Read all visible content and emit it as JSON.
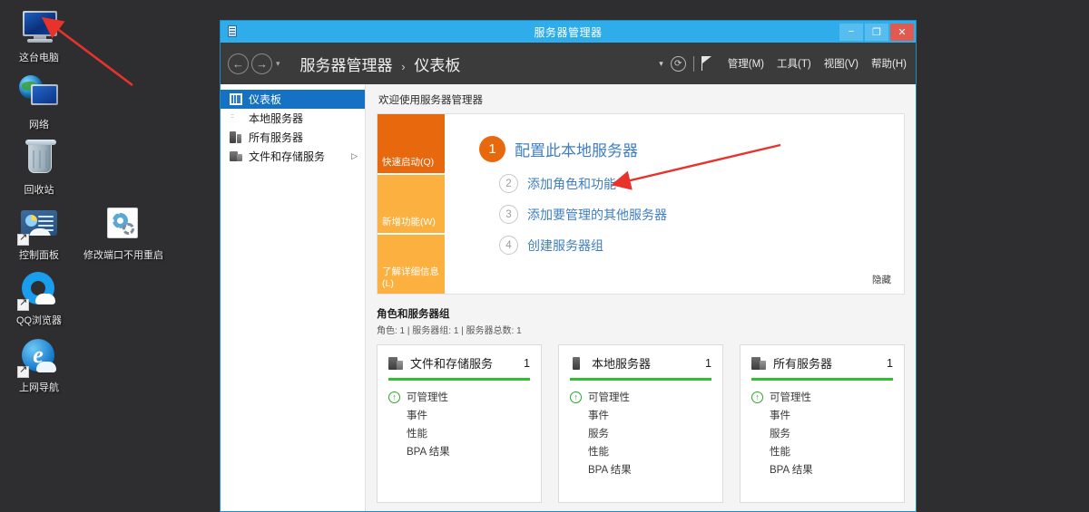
{
  "desktop": {
    "icons": [
      {
        "label": "这台电脑",
        "icon": "my-computer-icon"
      },
      {
        "label": "网络",
        "icon": "network-icon"
      },
      {
        "label": "回收站",
        "icon": "recycle-bin-icon"
      },
      {
        "label": "控制面板",
        "icon": "control-panel-icon"
      },
      {
        "label": "修改端口不用重启",
        "icon": "gear-tool-icon"
      },
      {
        "label": "QQ浏览器",
        "icon": "qq-browser-icon"
      },
      {
        "label": "上网导航",
        "icon": "internet-explorer-icon"
      }
    ]
  },
  "window": {
    "title": "服务器管理器",
    "icon": "server-manager-icon",
    "controls": {
      "minimize": "−",
      "maximize": "❐",
      "close": "✕"
    },
    "nav": {
      "back": "←",
      "forward": "→",
      "caret": "▾"
    },
    "breadcrumb": {
      "root": "服务器管理器",
      "separator": "›",
      "current": "仪表板"
    },
    "toolbar": {
      "notify_caret": "▾",
      "refresh": "⟳",
      "flag": "flag-icon",
      "menus": [
        {
          "label": "管理(M)",
          "name": "menu-manage"
        },
        {
          "label": "工具(T)",
          "name": "menu-tools"
        },
        {
          "label": "视图(V)",
          "name": "menu-view"
        },
        {
          "label": "帮助(H)",
          "name": "menu-help"
        }
      ]
    }
  },
  "sidebar": {
    "items": [
      {
        "label": "仪表板",
        "icon": "dashboard-icon",
        "active": true,
        "chevron": ""
      },
      {
        "label": "本地服务器",
        "icon": "server-icon",
        "active": false,
        "chevron": ""
      },
      {
        "label": "所有服务器",
        "icon": "servers-icon",
        "active": false,
        "chevron": ""
      },
      {
        "label": "文件和存储服务",
        "icon": "file-storage-icon",
        "active": false,
        "chevron": "▷"
      }
    ]
  },
  "welcome": {
    "heading": "欢迎使用服务器管理器",
    "tabs": [
      {
        "label": "快速启动(Q)",
        "color": "#e8690d",
        "name": "tab-quick-start"
      },
      {
        "label": "新增功能(W)",
        "color": "#fbb040",
        "name": "tab-whats-new"
      },
      {
        "label": "了解详细信息(L)",
        "color": "#fbb040",
        "name": "tab-learn-more"
      }
    ],
    "steps": [
      {
        "num": "1",
        "label": "配置此本地服务器",
        "primary": true
      },
      {
        "num": "2",
        "label": "添加角色和功能",
        "primary": false
      },
      {
        "num": "3",
        "label": "添加要管理的其他服务器",
        "primary": false
      },
      {
        "num": "4",
        "label": "创建服务器组",
        "primary": false
      }
    ],
    "hide_label": "隐藏"
  },
  "groups": {
    "title": "角色和服务器组",
    "subtitle": "角色: 1 | 服务器组: 1 | 服务器总数: 1",
    "cards": [
      {
        "title": "文件和存储服务",
        "count": "1",
        "icon": "file-storage-icon",
        "single": false,
        "rows": [
          "可管理性",
          "事件",
          "性能",
          "BPA 结果"
        ]
      },
      {
        "title": "本地服务器",
        "count": "1",
        "icon": "server-icon",
        "single": true,
        "rows": [
          "可管理性",
          "事件",
          "服务",
          "性能",
          "BPA 结果"
        ]
      },
      {
        "title": "所有服务器",
        "count": "1",
        "icon": "servers-icon",
        "single": false,
        "rows": [
          "可管理性",
          "事件",
          "服务",
          "性能",
          "BPA 结果"
        ]
      }
    ],
    "status_ok_glyph": "↑",
    "rule_color": "#2ec12e"
  }
}
